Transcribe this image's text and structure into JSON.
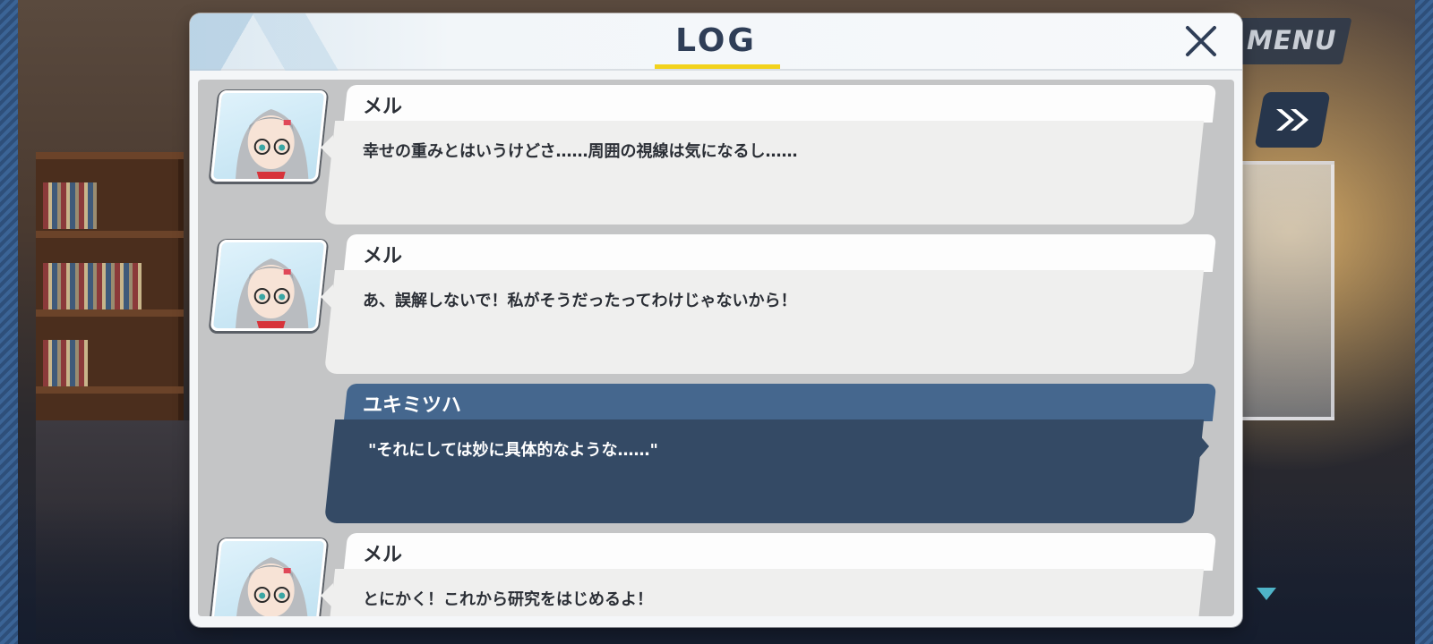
{
  "menu": {
    "label": "MENU"
  },
  "controls": {
    "fast_forward_icon": "double-chevron-right-icon",
    "scroll_indicator_icon": "triangle-down-icon"
  },
  "log": {
    "title": "LOG",
    "close_icon": "close-icon",
    "accent_color": "#f2d21c",
    "entries": [
      {
        "speaker": "メル",
        "text": "幸せの重みとはいうけどさ……周囲の視線は気になるし……",
        "is_player": false
      },
      {
        "speaker": "メル",
        "text": "あ、誤解しないで！私がそうだったってわけじゃないから！",
        "is_player": false
      },
      {
        "speaker": "ユキミツハ",
        "text": "\"それにしては妙に具体的なような……\"",
        "is_player": true
      },
      {
        "speaker": "メル",
        "text": "とにかく！これから研究をはじめるよ！",
        "is_player": false
      }
    ]
  },
  "colors": {
    "player_name_bg": "#45678e",
    "player_body_bg": "#344a65",
    "npc_body_bg": "#efefee",
    "title_color": "#2f3e57"
  }
}
